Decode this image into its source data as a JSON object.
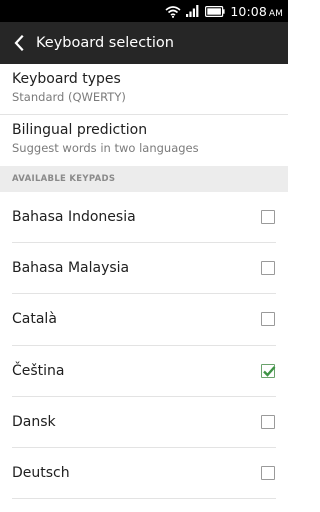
{
  "status": {
    "time": "10:08",
    "ampm": "AM"
  },
  "appbar": {
    "title": "Keyboard selection"
  },
  "prefs": [
    {
      "title": "Keyboard types",
      "summary": "Standard (QWERTY)"
    },
    {
      "title": "Bilingual prediction",
      "summary": "Suggest words in two languages"
    }
  ],
  "section": {
    "header": "AVAILABLE KEYPADS"
  },
  "keypads": [
    {
      "label": "Bahasa Indonesia",
      "checked": false
    },
    {
      "label": "Bahasa Malaysia",
      "checked": false
    },
    {
      "label": "Català",
      "checked": false
    },
    {
      "label": "Čeština",
      "checked": true
    },
    {
      "label": "Dansk",
      "checked": false
    },
    {
      "label": "Deutsch",
      "checked": false
    }
  ],
  "colors": {
    "appbar": "#262626",
    "check": "#3f9447"
  }
}
